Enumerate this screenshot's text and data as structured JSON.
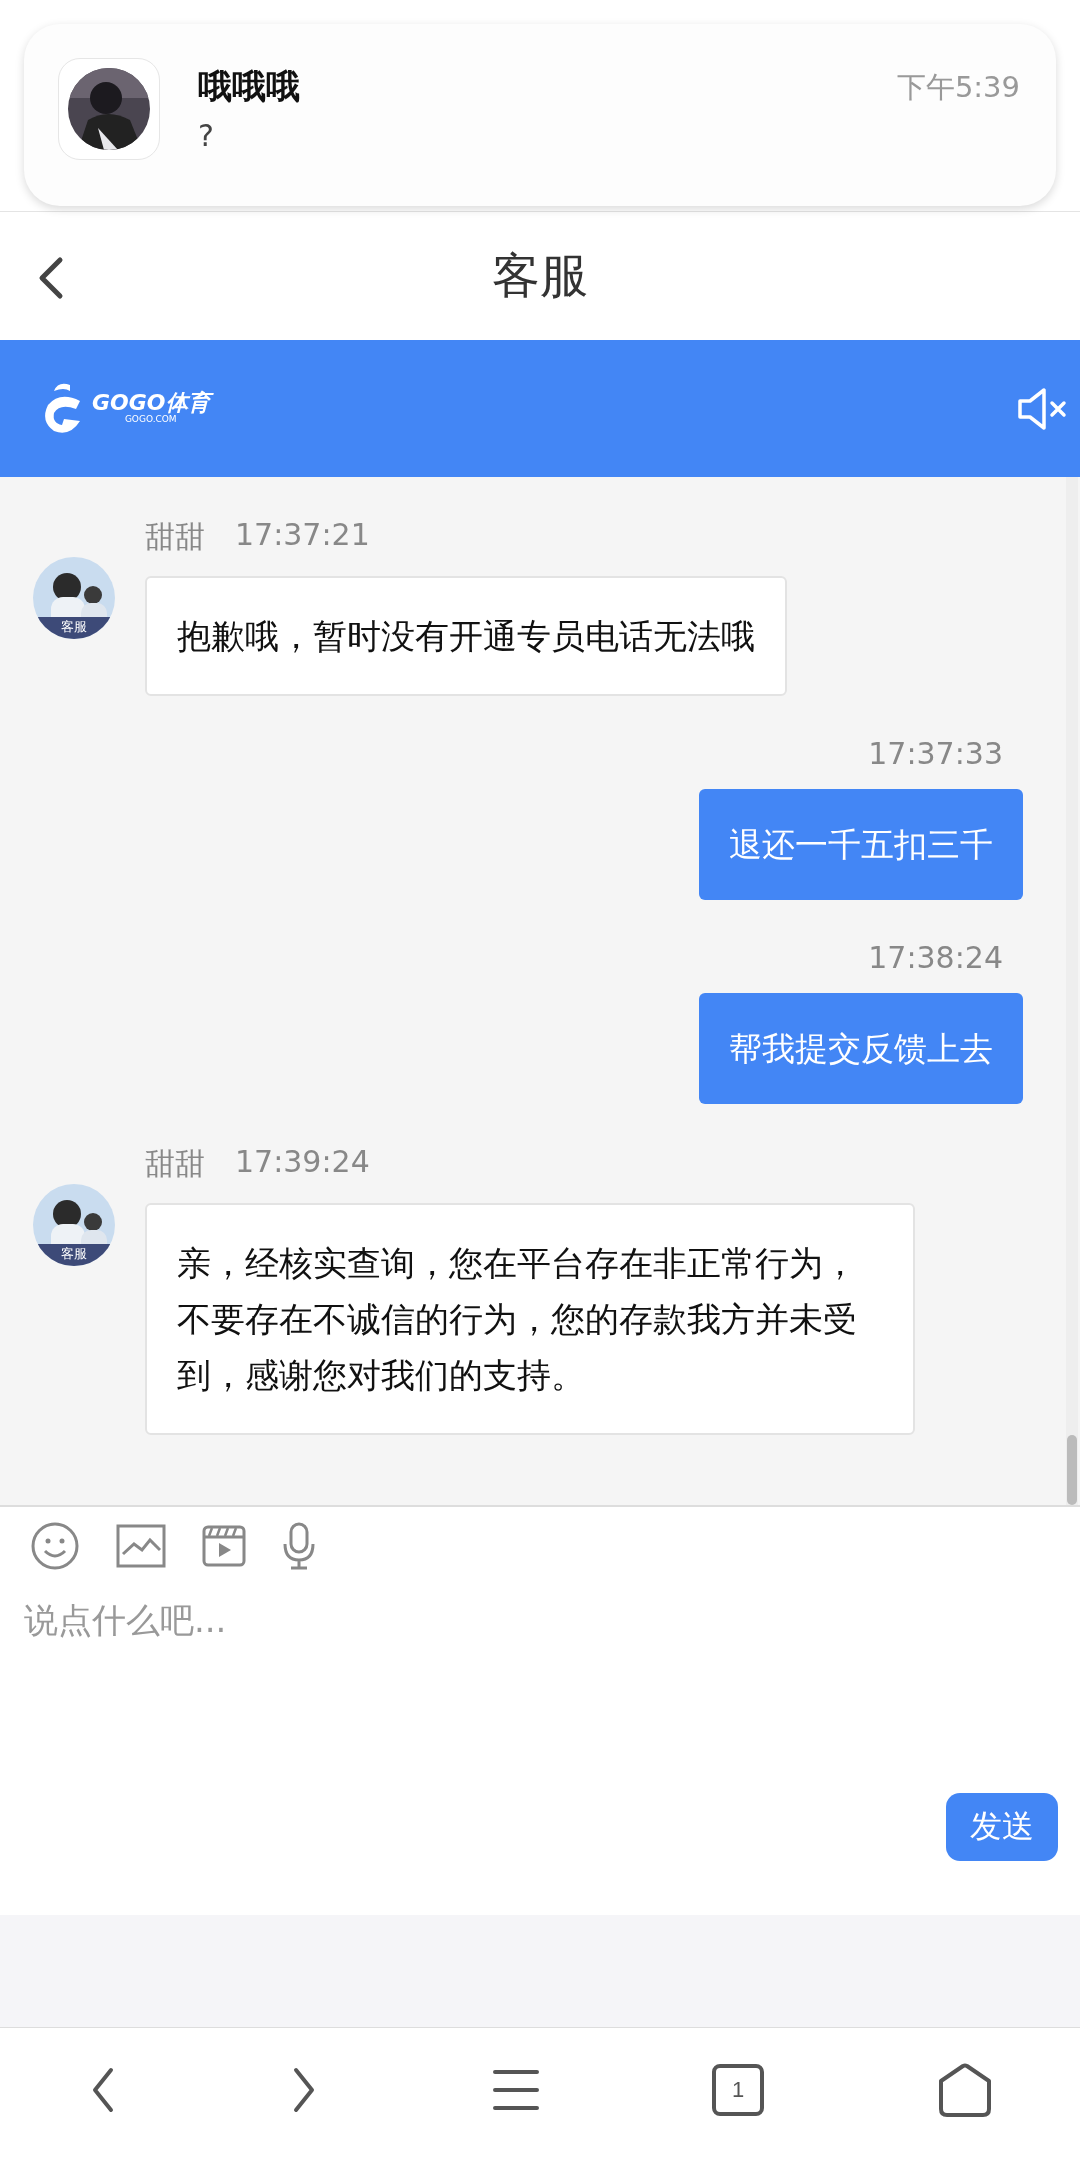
{
  "notification": {
    "sender": "哦哦哦",
    "message": "?",
    "time": "下午5:39"
  },
  "header": {
    "title": "客服"
  },
  "banner": {
    "logo_name": "GOGO体育",
    "logo_domain": "GOGO.COM"
  },
  "messages": [
    {
      "kind": "agent",
      "name": "甜甜",
      "time": "17:37:21",
      "avatar_label": "客服",
      "text": "抱歉哦，暂时没有开通专员电话无法哦"
    },
    {
      "kind": "user",
      "time": "17:37:33",
      "text": "退还一千五扣三千"
    },
    {
      "kind": "user",
      "time": "17:38:24",
      "text": "帮我提交反馈上去"
    },
    {
      "kind": "agent",
      "name": "甜甜",
      "time": "17:39:24",
      "avatar_label": "客服",
      "text": "亲，经核实查询，您在平台存在非正常行为，不要存在不诚信的行为，您的存款我方并未受到，感谢您对我们的支持。"
    }
  ],
  "composer": {
    "placeholder": "说点什么吧...",
    "send": "发送"
  },
  "bottom_nav": {
    "tab_count": "1"
  }
}
